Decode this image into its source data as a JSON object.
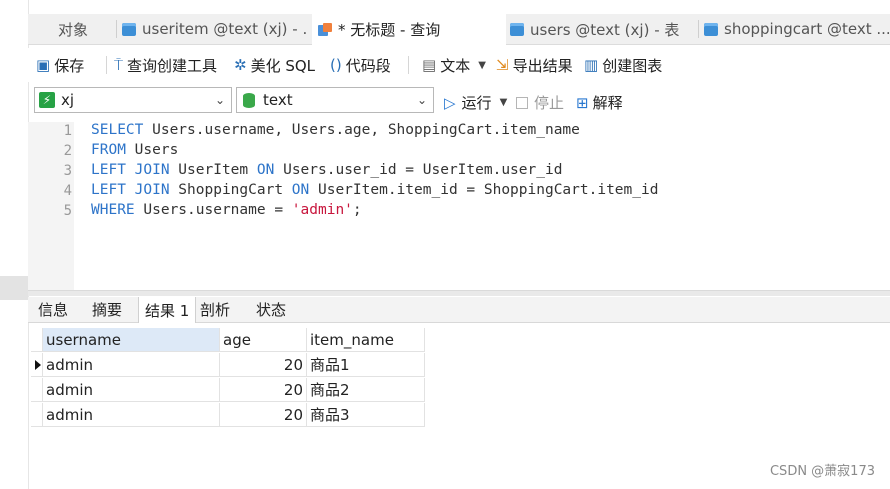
{
  "tabs": [
    {
      "label": "对象",
      "icon": "none"
    },
    {
      "label": "useritem @text (xj) - ...",
      "icon": "table-icon"
    },
    {
      "label": "* 无标题 - 查询",
      "icon": "query-icon",
      "active": true
    },
    {
      "label": "users @text (xj) - 表",
      "icon": "table-icon"
    },
    {
      "label": "shoppingcart @text ...",
      "icon": "table-icon"
    }
  ],
  "toolbar": {
    "save": "保存",
    "query_builder": "查询创建工具",
    "beautify": "美化 SQL",
    "snippet": "代码段",
    "text": "文本",
    "export": "导出结果",
    "create_chart": "创建图表"
  },
  "selectors": {
    "connection": "xj",
    "database": "text",
    "run": "运行",
    "stop": "停止",
    "explain": "解释"
  },
  "editor": {
    "line_numbers": [
      "1",
      "2",
      "3",
      "4",
      "5"
    ]
  },
  "result_tabs": [
    "信息",
    "摘要",
    "结果 1",
    "剖析",
    "状态"
  ],
  "result": {
    "columns": [
      "username",
      "age",
      "item_name"
    ],
    "rows": [
      [
        "admin",
        "20",
        "商品1"
      ],
      [
        "admin",
        "20",
        "商品2"
      ],
      [
        "admin",
        "20",
        "商品3"
      ]
    ]
  },
  "watermark": "CSDN @萧寂173",
  "colors": {
    "keyword": "#2d74c9",
    "string": "#c8163d",
    "accent": "#3d8fd6"
  }
}
